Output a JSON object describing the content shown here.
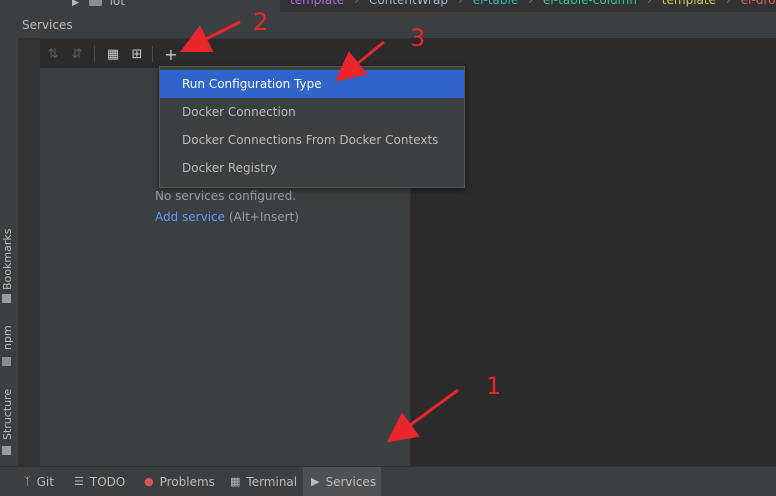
{
  "top_strip": {
    "tree_item": "iot",
    "breadcrumb": [
      "template",
      "ContentWrap",
      "el-table",
      "el-table-column",
      "template",
      "el-dropd"
    ],
    "breadcrumb_colors": [
      "#b467d8",
      "#a9b7c6",
      "#2fb3b0",
      "#34c28b",
      "#d8c84a",
      "#e05a5a"
    ]
  },
  "services": {
    "title": "Services",
    "empty_text": "No services configured.",
    "add_service_label": "Add service",
    "add_service_hint": "(Alt+Insert)"
  },
  "toolbar": {
    "expand_all_icon": "expand-all-icon",
    "collapse_all_icon": "collapse-all-icon",
    "group_by_icon": "group-by-icon",
    "new_tab_icon": "open-new-tab-icon",
    "add_icon": "add-icon"
  },
  "popup_menu": {
    "items": [
      {
        "label": "Run Configuration Type",
        "selected": true
      },
      {
        "label": "Docker Connection",
        "selected": false
      },
      {
        "label": "Docker Connections From Docker Contexts",
        "selected": false
      },
      {
        "label": "Docker Registry",
        "selected": false
      }
    ]
  },
  "left_strip": {
    "tabs": [
      {
        "label": "Bookmarks",
        "icon": "bookmark-icon"
      },
      {
        "label": "npm",
        "icon": "npm-icon"
      },
      {
        "label": "Structure",
        "icon": "structure-icon"
      }
    ]
  },
  "bottom_bar": {
    "tabs": [
      {
        "label": "Git",
        "icon": "git-icon",
        "active": false
      },
      {
        "label": "TODO",
        "icon": "todo-icon",
        "active": false
      },
      {
        "label": "Problems",
        "icon": "problems-icon",
        "active": false
      },
      {
        "label": "Terminal",
        "icon": "terminal-icon",
        "active": false
      },
      {
        "label": "Services",
        "icon": "services-icon",
        "active": true
      }
    ]
  },
  "annotations": {
    "numbers": [
      "1",
      "2",
      "3"
    ],
    "color": "#e8262b"
  },
  "colors": {
    "selection": "#2f65ca",
    "link": "#589df6",
    "panel": "#3c3f41",
    "editor": "#2b2b2b"
  }
}
